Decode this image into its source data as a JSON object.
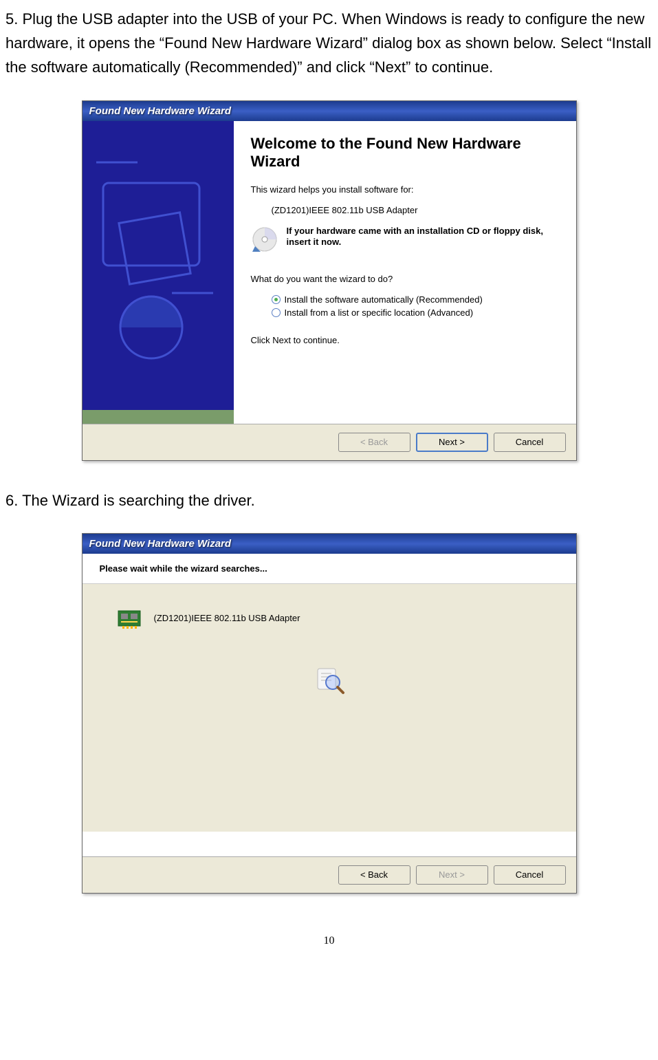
{
  "step5_text": "5. Plug the USB adapter into the USB of your PC. When Windows is ready to configure the new hardware, it opens the “Found New Hardware Wizard” dialog box as shown below. Select “Install the software automatically (Recommended)” and click “Next” to continue.",
  "step6_text": "6. The Wizard is searching the driver.",
  "wizard1": {
    "title": "Found New Hardware Wizard",
    "heading": "Welcome to the Found New Hardware Wizard",
    "intro": "This wizard helps you install software for:",
    "device": "(ZD1201)IEEE 802.11b USB Adapter",
    "cd_hint": "If your hardware came with an installation CD or floppy disk, insert it now.",
    "question": "What do you want the wizard to do?",
    "option1": "Install the software automatically (Recommended)",
    "option2": "Install from a list or specific location (Advanced)",
    "click_next": "Click Next to continue.",
    "back": "< Back",
    "next": "Next >",
    "cancel": "Cancel"
  },
  "wizard2": {
    "title": "Found New Hardware Wizard",
    "heading": "Please wait while the wizard searches...",
    "device": "(ZD1201)IEEE 802.11b USB Adapter",
    "back": "< Back",
    "next": "Next >",
    "cancel": "Cancel"
  },
  "page_number": "10"
}
